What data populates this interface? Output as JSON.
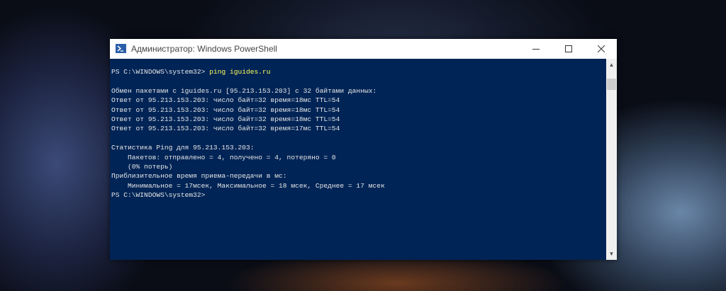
{
  "window": {
    "title": "Администратор: Windows PowerShell"
  },
  "console": {
    "prompt": "PS C:\\WINDOWS\\system32> ",
    "command": "ping iguides.ru",
    "lines": [
      "",
      "Обмен пакетами с iguides.ru [95.213.153.203] с 32 байтами данных:",
      "Ответ от 95.213.153.203: число байт=32 время=18мс TTL=54",
      "Ответ от 95.213.153.203: число байт=32 время=18мс TTL=54",
      "Ответ от 95.213.153.203: число байт=32 время=18мс TTL=54",
      "Ответ от 95.213.153.203: число байт=32 время=17мс TTL=54",
      "",
      "Статистика Ping для 95.213.153.203:",
      "    Пакетов: отправлено = 4, получено = 4, потеряно = 0",
      "    (0% потерь)",
      "Приблизительное время приема-передачи в мс:",
      "    Минимальное = 17мсек, Максимальное = 18 мсек, Среднее = 17 мсек",
      "PS C:\\WINDOWS\\system32>"
    ]
  },
  "colors": {
    "console_bg": "#012456",
    "command": "#ffff5a"
  }
}
